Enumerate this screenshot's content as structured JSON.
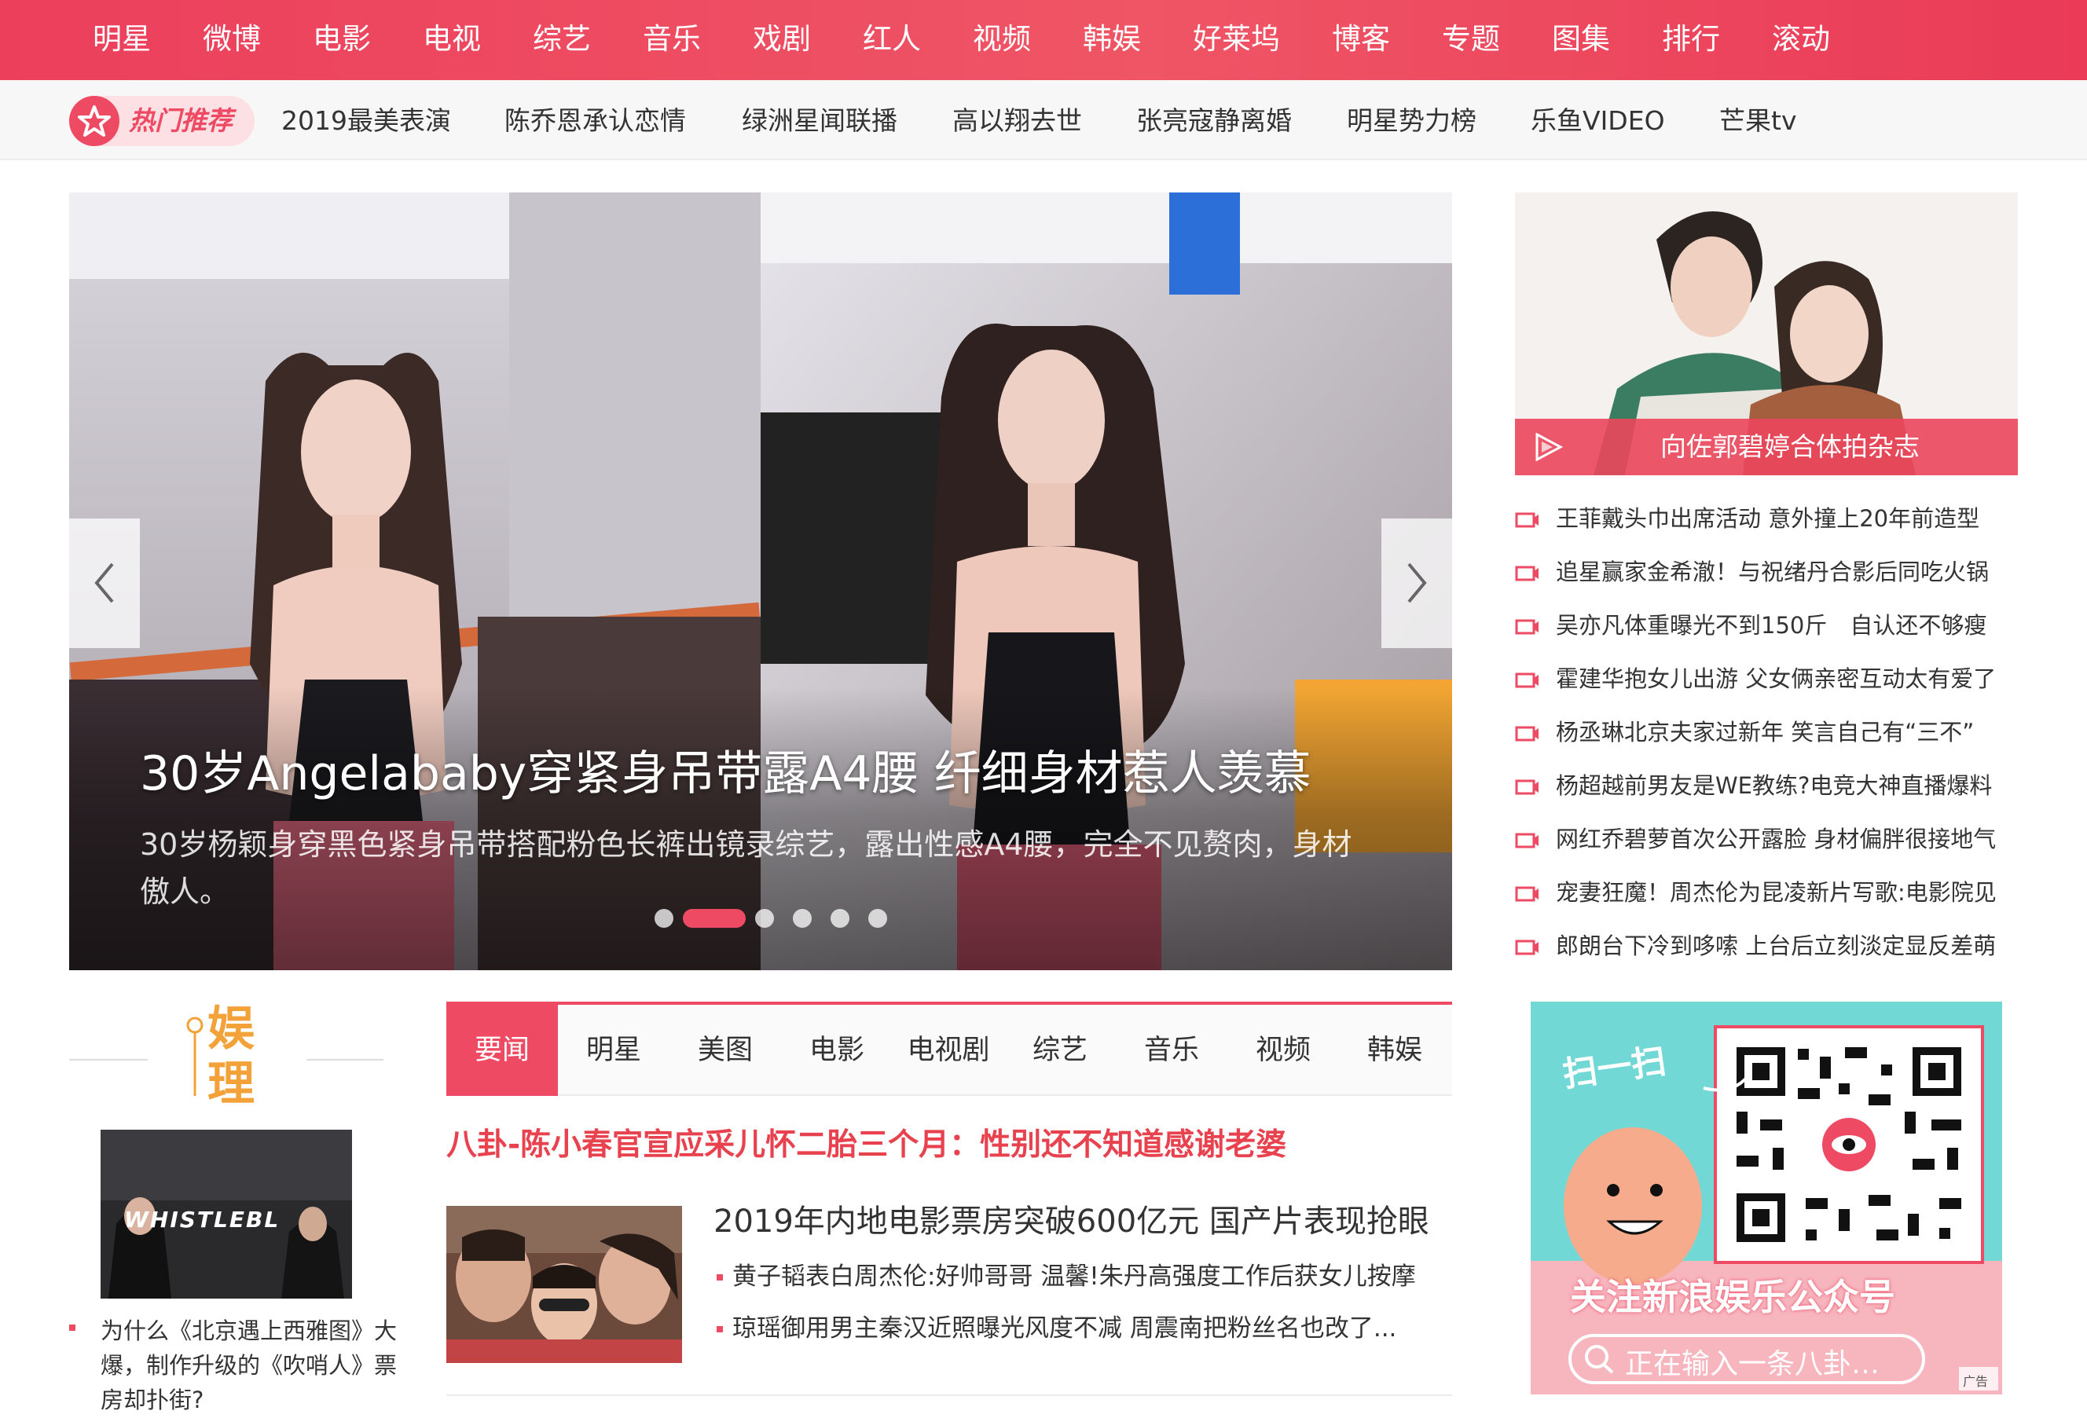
{
  "top_nav": [
    "明星",
    "微博",
    "电影",
    "电视",
    "综艺",
    "音乐",
    "戏剧",
    "红人",
    "视频",
    "韩娱",
    "好莱坞",
    "博客",
    "专题",
    "图集",
    "排行",
    "滚动"
  ],
  "hot_bar": {
    "label": "热门推荐",
    "links": [
      "2019最美表演",
      "陈乔恩承认恋情",
      "绿洲星闻联播",
      "高以翔去世",
      "张亮寇静离婚",
      "明星势力榜",
      "乐鱼VIDEO",
      "芒果tv"
    ]
  },
  "carousel": {
    "title": "30岁Angelababy穿紧身吊带露A4腰 纤细身材惹人羡慕",
    "description": "30岁杨颖身穿黑色紧身吊带搭配粉色长裤出镜录综艺，露出性感A4腰，完全不见赘肉，身材傲人。",
    "slide_count": 6,
    "active_slide": 2
  },
  "feature": {
    "title": "向佐郭碧婷合体拍杂志"
  },
  "news_list": [
    "王菲戴头巾出席活动 意外撞上20年前造型",
    "追星赢家金希澈！与祝绪丹合影后同吃火锅",
    "吴亦凡体重曝光不到150斤　自认还不够瘦",
    "霍建华抱女儿出游 父女俩亲密互动太有爱了",
    "杨丞琳北京夫家过新年 笑言自己有“三不”",
    "杨超越前男友是WE教练?电竞大神直播爆料",
    "网红乔碧萝首次公开露脸 身材偏胖很接地气",
    "宠妻狂魔！周杰伦为昆凌新片写歌:电影院见",
    "郎朗台下冷到哆嗦 上台后立刻淡定显反差萌"
  ],
  "ad": {
    "scan_text": "扫一扫",
    "follow_text": "关注新浪娱乐公众号",
    "search_text": "正在输入一条八卦…",
    "badge": "广告"
  },
  "left_column": {
    "logo_chars": [
      "娱",
      "理"
    ],
    "thumb_text": "WHISTLEBL",
    "caption": "为什么《北京遇上西雅图》大爆，制作升级的《吹哨人》票房却扑街?"
  },
  "tabs": [
    "要闻",
    "明星",
    "美图",
    "电影",
    "电视剧",
    "综艺",
    "音乐",
    "视频",
    "韩娱"
  ],
  "active_tab": 0,
  "headline": "八卦-陈小春官宣应采儿怀二胎三个月：性别还不知道感谢老婆",
  "story": {
    "title": "2019年内地电影票房突破600亿元 国产片表现抢眼",
    "sub_items": [
      "黄子韬表白周杰伦:好帅哥哥 温馨!朱丹高强度工作后获女儿按摩",
      "琼瑶御用男主秦汉近照曝光风度不减 周震南把粉丝名也改了..."
    ]
  },
  "colors": {
    "brand": "#ef4a63",
    "headline": "#e8424f",
    "nav_bg": "#ec3f5c"
  }
}
